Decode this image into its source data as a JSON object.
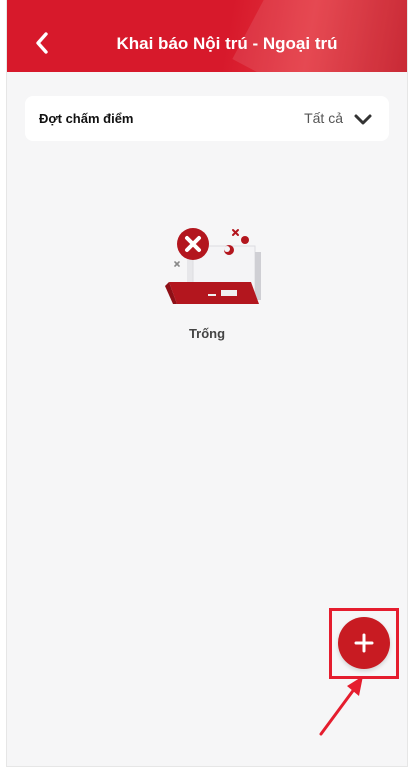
{
  "header": {
    "title": "Khai báo Nội trú - Ngoại trú",
    "back_icon": "chevron-left-icon"
  },
  "filter": {
    "label": "Đợt chấm điểm",
    "selected_value": "Tất cả",
    "dropdown_icon": "chevron-down-icon"
  },
  "empty_state": {
    "illustration": "empty-document-error-icon",
    "text": "Trống"
  },
  "fab": {
    "icon": "plus-icon"
  },
  "annotation": {
    "highlight_color": "#e51d2e",
    "arrow_icon": "arrow-pointer-icon"
  },
  "colors": {
    "brand_red": "#d7192b",
    "fab_red": "#c81b22",
    "background": "#f6f6f7"
  }
}
